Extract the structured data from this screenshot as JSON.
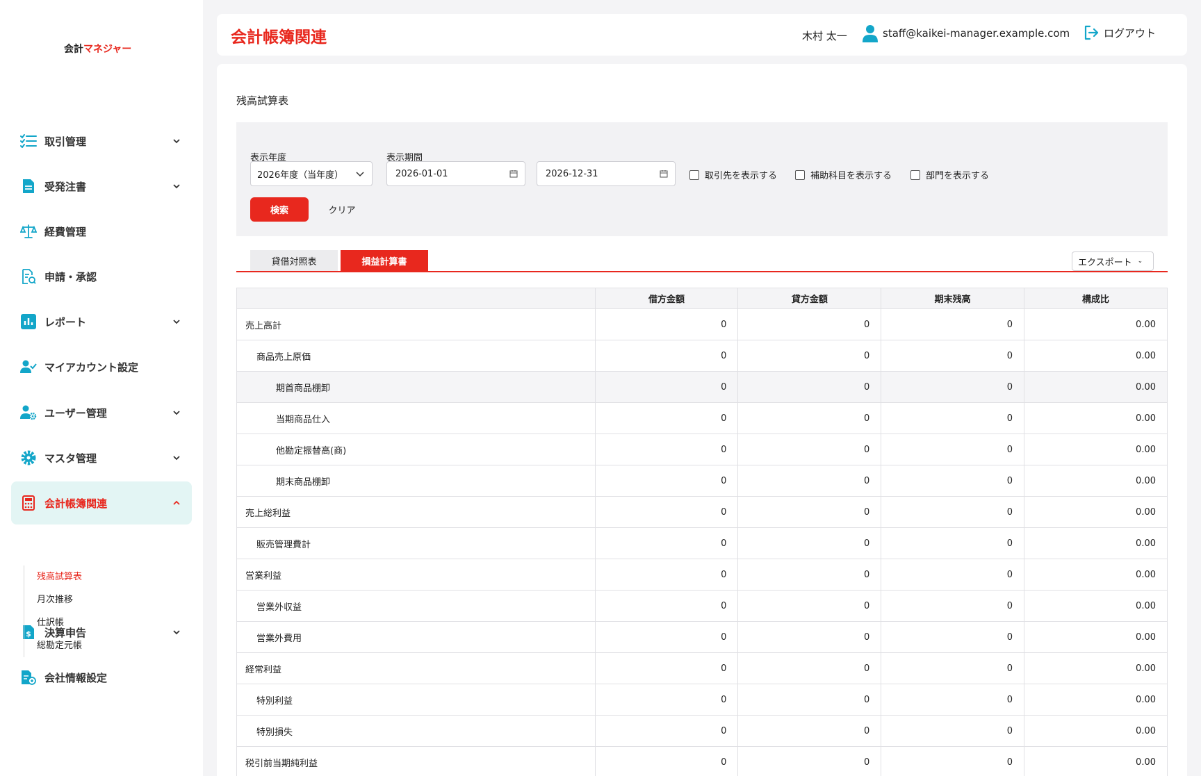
{
  "app": {
    "logo_main": "会計",
    "logo_accent": "マネジャー"
  },
  "sidebar": {
    "items": [
      {
        "label": "取引管理",
        "icon": "checklist-icon",
        "chevron": "down"
      },
      {
        "label": "受発注書",
        "icon": "document-icon",
        "chevron": "down"
      },
      {
        "label": "経費管理",
        "icon": "balance-scale-icon",
        "chevron": ""
      },
      {
        "label": "申請・承認",
        "icon": "approval-document-icon",
        "chevron": ""
      },
      {
        "label": "レポート",
        "icon": "bar-chart-icon",
        "chevron": "down"
      },
      {
        "label": "マイアカウント設定",
        "icon": "user-check-icon",
        "chevron": ""
      },
      {
        "label": "ユーザー管理",
        "icon": "user-gear-icon",
        "chevron": "down"
      },
      {
        "label": "マスタ管理",
        "icon": "gear-icon",
        "chevron": "down"
      },
      {
        "label": "会計帳簿関連",
        "icon": "calculator-icon",
        "chevron": "up",
        "active": true
      },
      {
        "label": "決算申告",
        "icon": "dollar-document-icon",
        "chevron": "down"
      },
      {
        "label": "会社情報設定",
        "icon": "company-document-icon",
        "chevron": ""
      }
    ],
    "subitems": [
      "残高試算表",
      "月次推移",
      "仕訳帳",
      "総勘定元帳"
    ],
    "current_subitem": "残高試算表"
  },
  "header": {
    "title": "会計帳簿関連",
    "user_name": "木村 太一",
    "email": "staff@kaikei-manager.example.com",
    "logout": "ログアウト"
  },
  "page": {
    "section_title": "残高試算表"
  },
  "filter": {
    "year_label": "表示年度",
    "year_value": "2026年度（当年度）",
    "period_label": "表示期間",
    "date_from": "2026-01-01",
    "date_to": "2026-12-31",
    "checkboxes": [
      "取引先を表示する",
      "補助科目を表示する",
      "部門を表示する"
    ],
    "search_button": "検索",
    "clear_button": "クリア"
  },
  "tabs": [
    "貸借対照表",
    "損益計算書"
  ],
  "active_tab": "損益計算書",
  "export_label": "エクスポート",
  "table": {
    "headers": [
      "",
      "借方金額",
      "貸方金額",
      "期末残高",
      "構成比"
    ],
    "rows": [
      {
        "name": "売上高計",
        "indent": 0,
        "cells": [
          "0",
          "0",
          "0",
          "0.00"
        ]
      },
      {
        "name": "商品売上原価",
        "indent": 1,
        "cells": [
          "0",
          "0",
          "0",
          "0.00"
        ]
      },
      {
        "name": "期首商品棚卸",
        "indent": 2,
        "cells": [
          "0",
          "0",
          "0",
          "0.00"
        ],
        "highlight": true
      },
      {
        "name": "当期商品仕入",
        "indent": 2,
        "cells": [
          "0",
          "0",
          "0",
          "0.00"
        ]
      },
      {
        "name": "他勘定振替高(商)",
        "indent": 2,
        "cells": [
          "0",
          "0",
          "0",
          "0.00"
        ]
      },
      {
        "name": "期末商品棚卸",
        "indent": 2,
        "cells": [
          "0",
          "0",
          "0",
          "0.00"
        ]
      },
      {
        "name": "売上総利益",
        "indent": 0,
        "cells": [
          "0",
          "0",
          "0",
          "0.00"
        ]
      },
      {
        "name": "販売管理費計",
        "indent": 1,
        "cells": [
          "0",
          "0",
          "0",
          "0.00"
        ]
      },
      {
        "name": "営業利益",
        "indent": 0,
        "cells": [
          "0",
          "0",
          "0",
          "0.00"
        ]
      },
      {
        "name": "営業外収益",
        "indent": 1,
        "cells": [
          "0",
          "0",
          "0",
          "0.00"
        ]
      },
      {
        "name": "営業外費用",
        "indent": 1,
        "cells": [
          "0",
          "0",
          "0",
          "0.00"
        ]
      },
      {
        "name": "経常利益",
        "indent": 0,
        "cells": [
          "0",
          "0",
          "0",
          "0.00"
        ]
      },
      {
        "name": "特別利益",
        "indent": 1,
        "cells": [
          "0",
          "0",
          "0",
          "0.00"
        ]
      },
      {
        "name": "特別損失",
        "indent": 1,
        "cells": [
          "0",
          "0",
          "0",
          "0.00"
        ]
      },
      {
        "name": "税引前当期純利益",
        "indent": 0,
        "cells": [
          "0",
          "0",
          "0",
          "0.00"
        ]
      }
    ]
  },
  "colors": {
    "accent": "#e8281e",
    "icon": "#13a6c9",
    "active_bg": "#e3f5f4"
  }
}
